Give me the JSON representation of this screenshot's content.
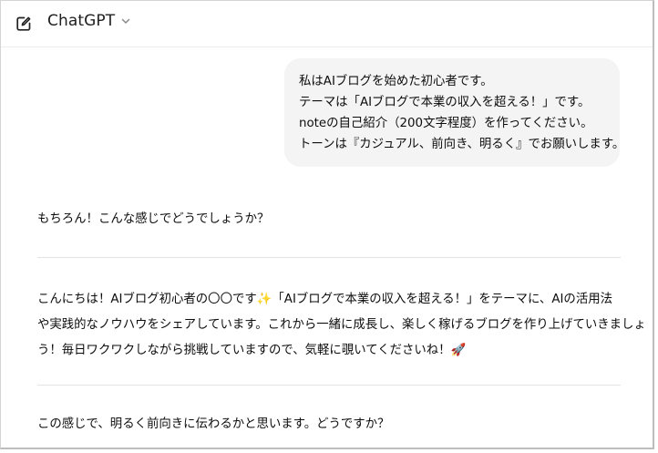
{
  "header": {
    "model_name": "ChatGPT",
    "edit_icon": "new-chat-icon",
    "chevron_icon": "chevron-down-icon"
  },
  "user_message": {
    "lines": [
      "私はAIブログを始めた初心者です。",
      "テーマは「AIブログで本業の収入を超える！」です。",
      "noteの自己紹介（200文字程度）を作ってください。",
      "トーンは『カジュアル、前向き、明るく』でお願いします。"
    ]
  },
  "assistant": {
    "intro": "もちろん！こんな感じでどうでしょうか？",
    "bio_lines": [
      "こんにちは！AIブログ初心者の〇〇です✨「AIブログで本業の収入を超える！」をテーマに、AIの活用法",
      "や実践的なノウハウをシェアしています。これから一緒に成長し、楽しく稼げるブログを作り上げていきましょ",
      "う！毎日ワクワクしながら挑戦していますので、気軽に覗いてくださいね！🚀"
    ],
    "outro": "この感じで、明るく前向きに伝わるかと思います。どうですか？"
  }
}
